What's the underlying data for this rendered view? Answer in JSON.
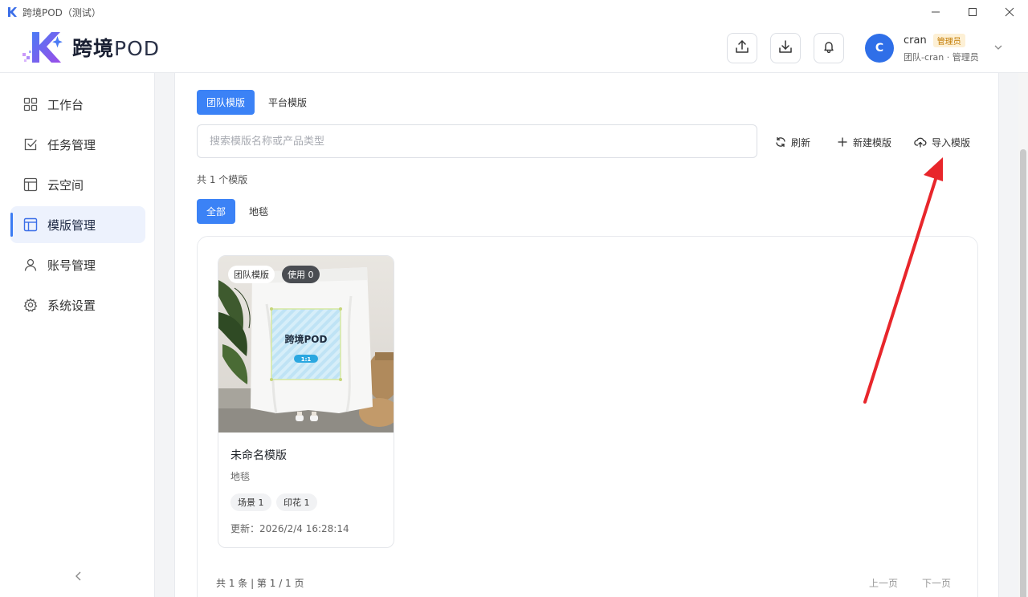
{
  "window": {
    "title": "跨境POD（测试）",
    "controls": [
      "minimize",
      "maximize",
      "close"
    ]
  },
  "brand": {
    "name": "跨境",
    "suffix": "POD"
  },
  "header": {
    "buttons": [
      {
        "icon": "upload-icon"
      },
      {
        "icon": "download-icon"
      },
      {
        "icon": "bell-icon"
      }
    ],
    "user": {
      "avatar_letter": "C",
      "name": "cran",
      "role_badge": "管理员",
      "team_line": "团队-cran · 管理员"
    }
  },
  "sidebar": {
    "items": [
      {
        "label": "工作台",
        "icon": "grid-icon",
        "active": false
      },
      {
        "label": "任务管理",
        "icon": "checkbox-icon",
        "active": false
      },
      {
        "label": "云空间",
        "icon": "layout-icon",
        "active": false
      },
      {
        "label": "模版管理",
        "icon": "template-icon",
        "active": true
      },
      {
        "label": "账号管理",
        "icon": "user-icon",
        "active": false
      },
      {
        "label": "系统设置",
        "icon": "gear-icon",
        "active": false
      }
    ],
    "collapse_glyph": "‹"
  },
  "main": {
    "tabs": [
      {
        "label": "团队模版",
        "active": true
      },
      {
        "label": "平台模版",
        "active": false
      }
    ],
    "search": {
      "placeholder": "搜索模版名称或产品类型",
      "value": ""
    },
    "actions": {
      "refresh": "刷新",
      "new_template": "新建模版",
      "import_template": "导入模版"
    },
    "count_text": "共 1 个模版",
    "filters": [
      {
        "label": "全部",
        "active": true
      },
      {
        "label": "地毯",
        "active": false
      }
    ],
    "templates": [
      {
        "tag_team": "团队模版",
        "tag_use": "使用 0",
        "preview_title": "跨境POD",
        "preview_ratio": "1:1",
        "name": "未命名模版",
        "category": "地毯",
        "chips": [
          "场景 1",
          "印花 1"
        ],
        "updated": "更新：2026/2/4 16:28:14"
      }
    ],
    "pagination": {
      "info": "共 1 条 | 第 1 / 1 页",
      "prev": "上一页",
      "next": "下一页"
    }
  },
  "colors": {
    "accent": "#3b82f6",
    "avatar": "#2f6fe8",
    "annotation_arrow": "#e8262b"
  }
}
